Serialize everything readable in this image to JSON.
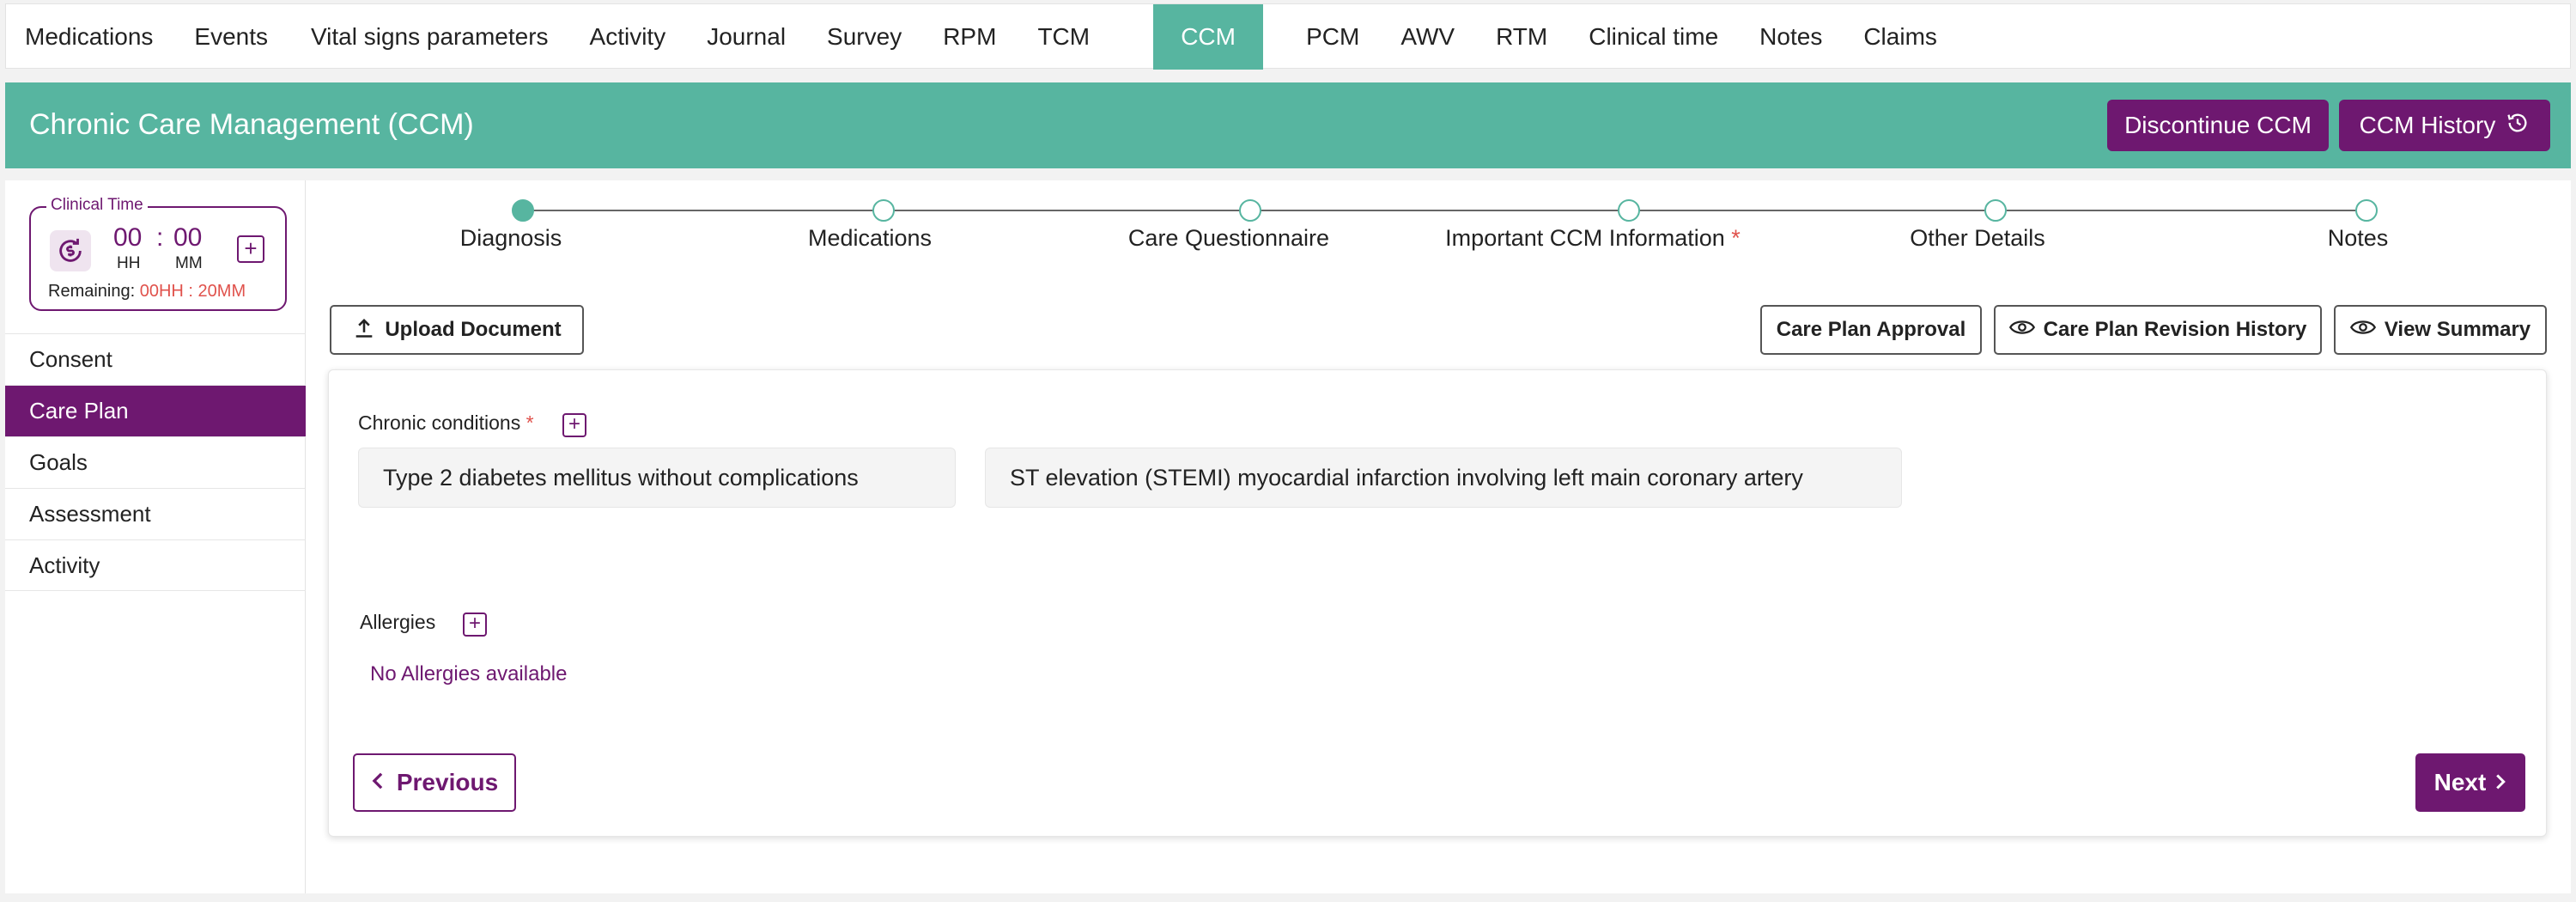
{
  "top_tabs": [
    {
      "label": "Medications"
    },
    {
      "label": "Events"
    },
    {
      "label": "Vital signs parameters"
    },
    {
      "label": "Activity"
    },
    {
      "label": "Journal"
    },
    {
      "label": "Survey"
    },
    {
      "label": "RPM"
    },
    {
      "label": "TCM"
    },
    {
      "label": "CCM",
      "active": true
    },
    {
      "label": "PCM"
    },
    {
      "label": "AWV"
    },
    {
      "label": "RTM"
    },
    {
      "label": "Clinical time"
    },
    {
      "label": "Notes"
    },
    {
      "label": "Claims"
    }
  ],
  "header": {
    "title": "Chronic Care Management (CCM)",
    "discontinue_label": "Discontinue CCM",
    "history_label": "CCM History"
  },
  "clinical_time": {
    "legend": "Clinical Time",
    "hours": "00",
    "separator": ":",
    "minutes": "00",
    "hours_label": "HH",
    "minutes_label": "MM",
    "remaining_label": "Remaining:",
    "remaining_value": "00HH : 20MM"
  },
  "sidebar": {
    "items": [
      {
        "label": "Consent"
      },
      {
        "label": "Care Plan",
        "active": true
      },
      {
        "label": "Goals"
      },
      {
        "label": "Assessment"
      },
      {
        "label": "Activity"
      }
    ]
  },
  "steps": [
    {
      "label": "Diagnosis",
      "active": true
    },
    {
      "label": "Medications"
    },
    {
      "label": "Care Questionnaire"
    },
    {
      "label": "Important CCM Information",
      "required": true
    },
    {
      "label": "Other Details"
    },
    {
      "label": "Notes"
    }
  ],
  "toolbar": {
    "upload_label": "Upload Document",
    "approval_label": "Care Plan Approval",
    "revision_label": "Care Plan Revision History",
    "summary_label": "View Summary"
  },
  "chronic_conditions": {
    "label": "Chronic conditions",
    "required_mark": "*",
    "items": [
      "Type 2 diabetes mellitus without complications",
      "ST elevation (STEMI) myocardial infarction involving left main coronary artery"
    ]
  },
  "allergies": {
    "label": "Allergies",
    "empty_text": "No Allergies available"
  },
  "nav": {
    "previous_label": "Previous",
    "next_label": "Next"
  },
  "colors": {
    "brand_teal": "#57b5a0",
    "brand_purple": "#6e1870",
    "required_red": "#e0524c"
  }
}
